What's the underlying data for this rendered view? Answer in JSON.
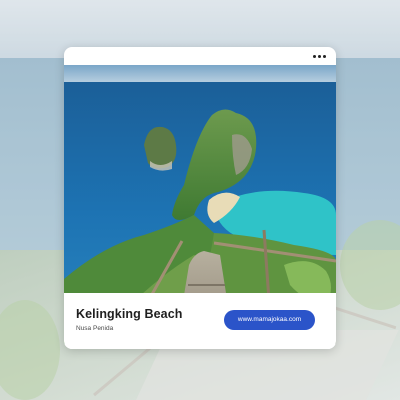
{
  "card": {
    "title": "Kelingking Beach",
    "subtitle": "Nusa Penida",
    "link_label": "www.mamajokaa.com",
    "menu_icon": "more-horizontal-icon"
  },
  "colors": {
    "button": "#2b54c9",
    "card_bg": "#ffffff",
    "ocean": "#1d73b3",
    "lagoon": "#2fc3c8",
    "cliff": "#4f8a3a"
  }
}
